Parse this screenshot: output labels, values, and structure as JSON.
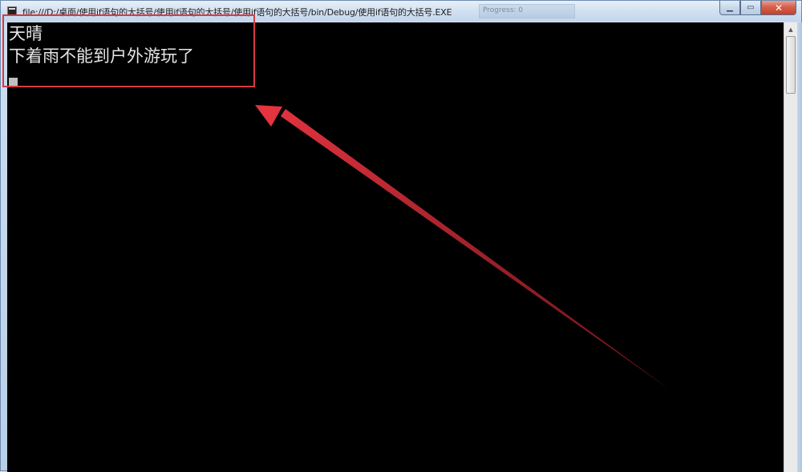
{
  "window": {
    "title": "file:///D:/桌面/使用if语句的大括号/使用if语句的大括号/使用if语句的大括号/bin/Debug/使用if语句的大括号.EXE",
    "background_title_fragment": "Progress: 0",
    "controls": {
      "minimize_icon": "minimize-icon",
      "maximize_icon": "maximize-icon",
      "close_icon": "close-icon"
    }
  },
  "console": {
    "lines": [
      "天晴",
      "下着雨不能到户外游玩了"
    ],
    "background_color": "#000000",
    "text_color": "#e6e6e6"
  },
  "annotation": {
    "color": "#d83a45"
  }
}
